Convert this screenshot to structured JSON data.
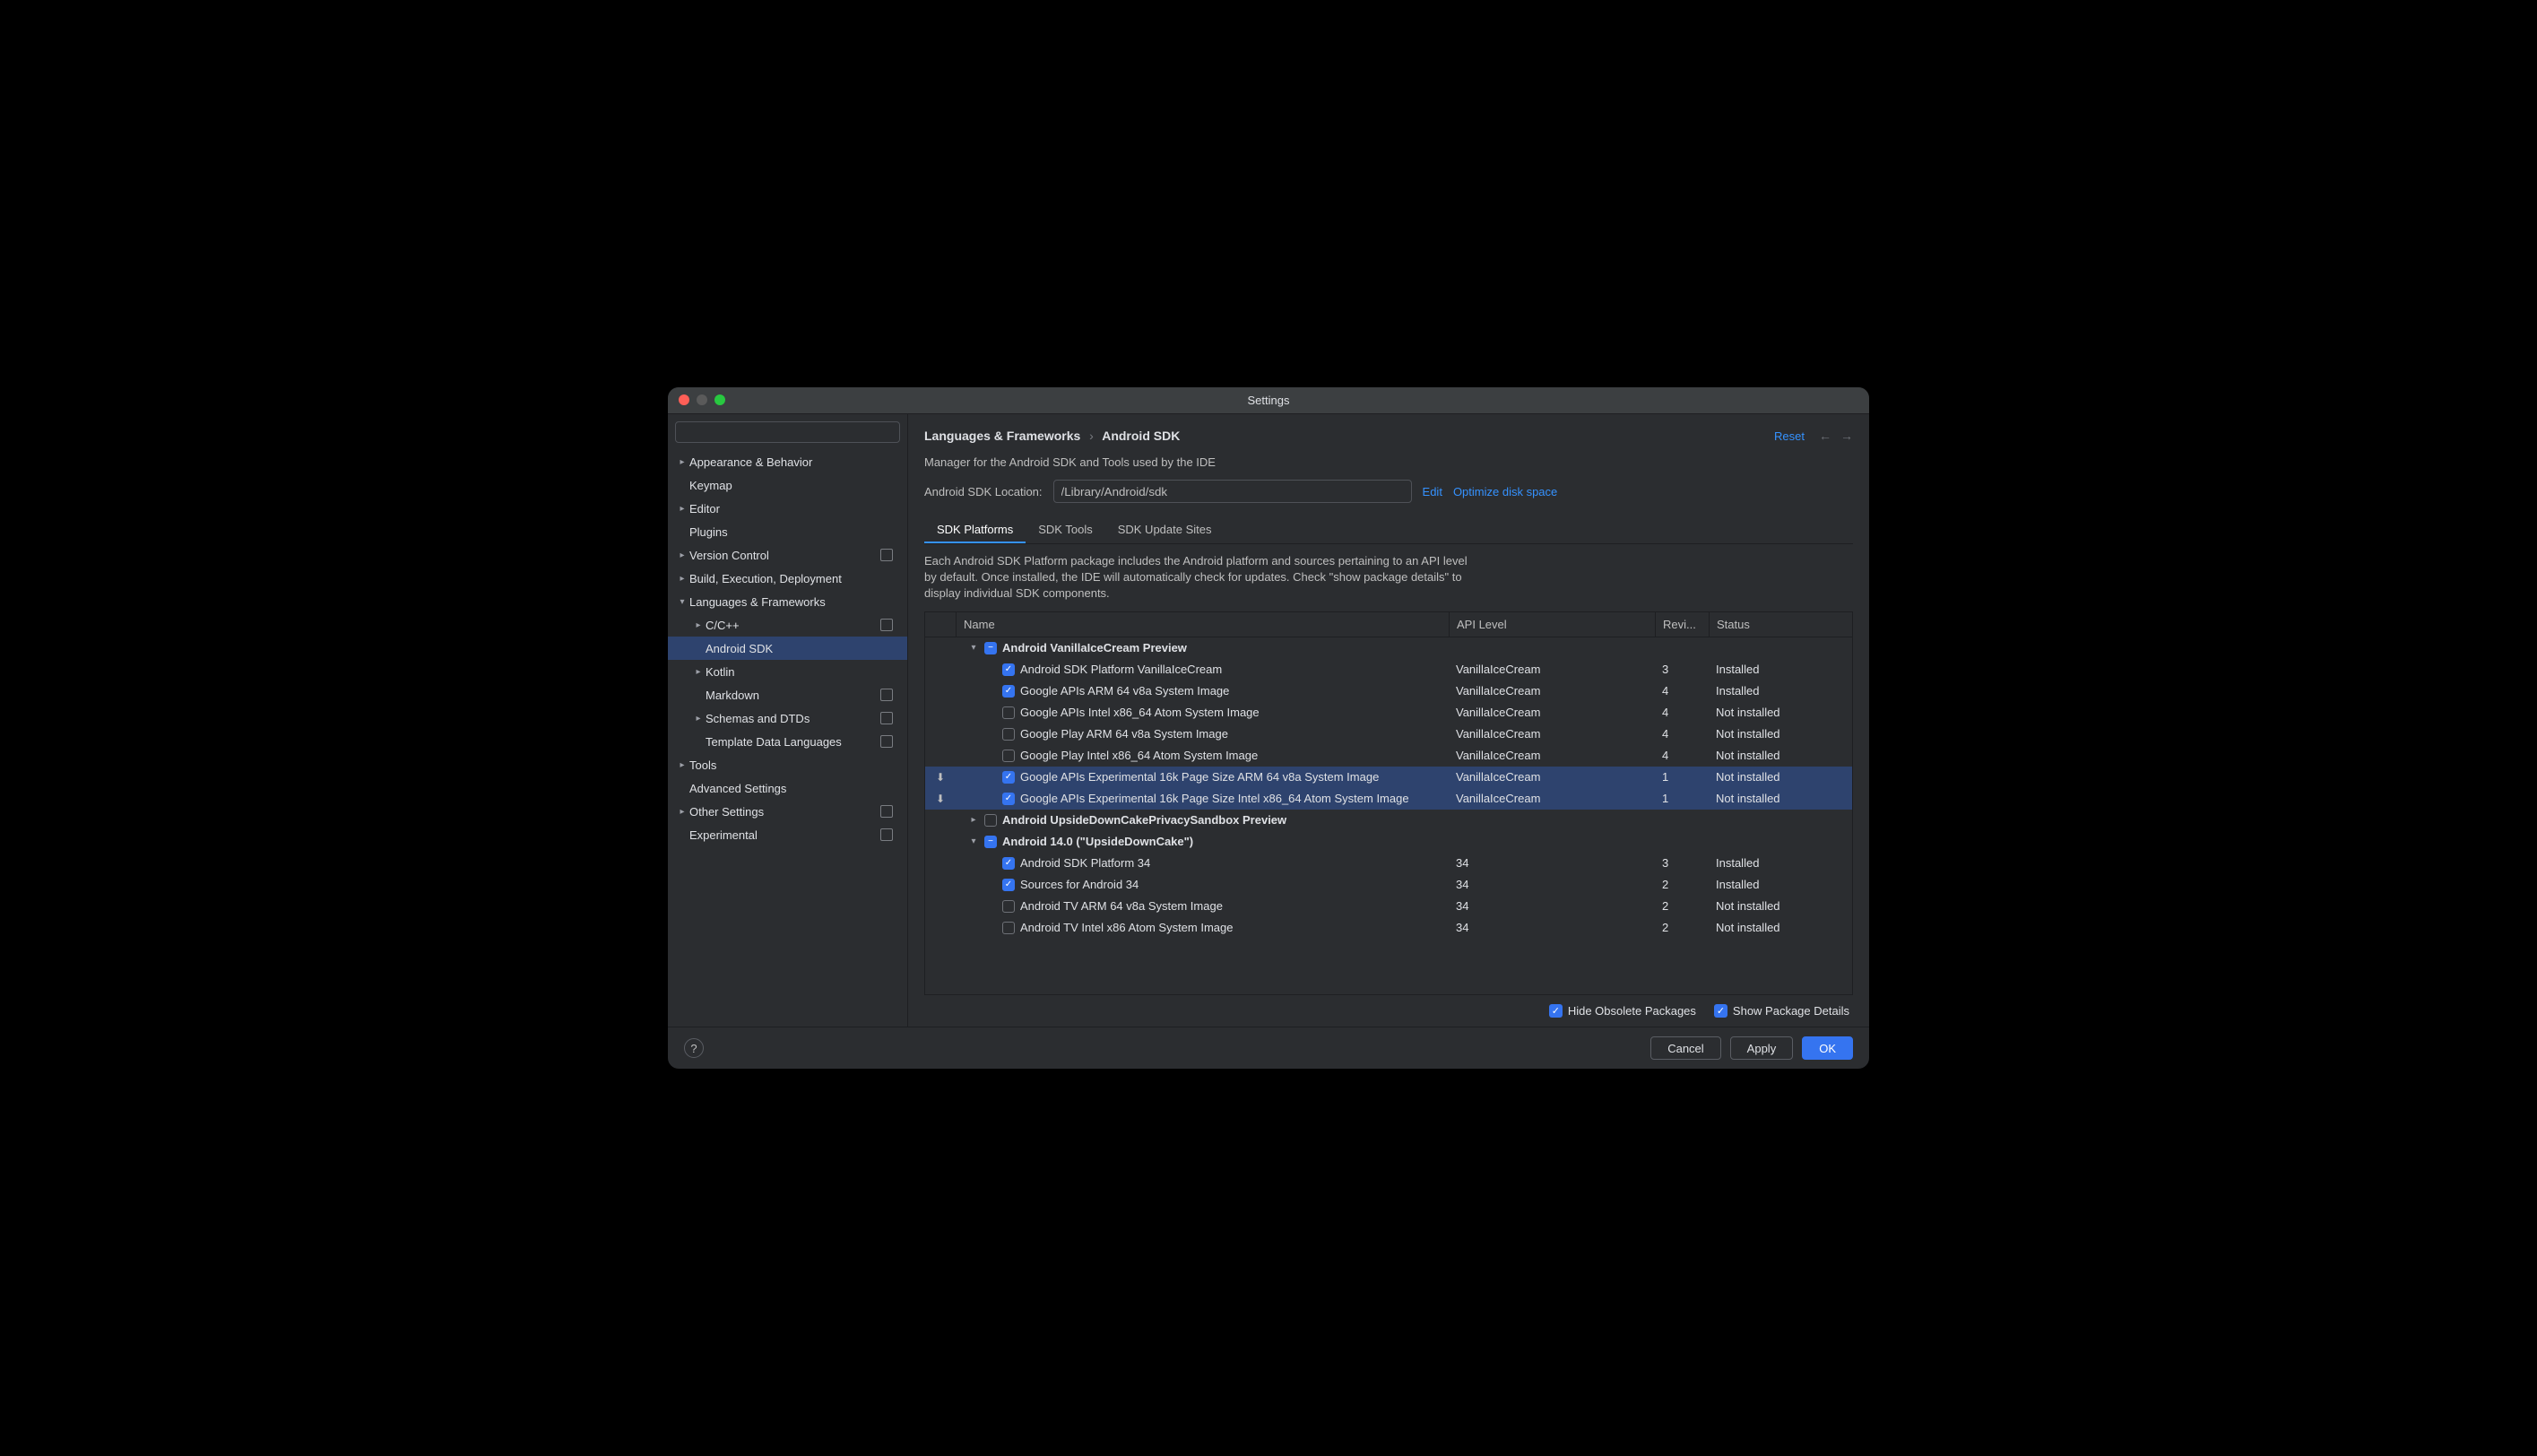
{
  "window": {
    "title": "Settings"
  },
  "search": {
    "placeholder": ""
  },
  "sidebar": {
    "items": [
      {
        "label": "Appearance & Behavior",
        "depth": 0,
        "chev": "right",
        "mod": false
      },
      {
        "label": "Keymap",
        "depth": 0,
        "chev": "none",
        "mod": false
      },
      {
        "label": "Editor",
        "depth": 0,
        "chev": "right",
        "mod": false
      },
      {
        "label": "Plugins",
        "depth": 0,
        "chev": "none",
        "mod": false
      },
      {
        "label": "Version Control",
        "depth": 0,
        "chev": "right",
        "mod": true
      },
      {
        "label": "Build, Execution, Deployment",
        "depth": 0,
        "chev": "right",
        "mod": false
      },
      {
        "label": "Languages & Frameworks",
        "depth": 0,
        "chev": "down",
        "mod": false
      },
      {
        "label": "C/C++",
        "depth": 1,
        "chev": "right",
        "mod": true
      },
      {
        "label": "Android SDK",
        "depth": 1,
        "chev": "none",
        "mod": false,
        "selected": true
      },
      {
        "label": "Kotlin",
        "depth": 1,
        "chev": "right",
        "mod": false
      },
      {
        "label": "Markdown",
        "depth": 1,
        "chev": "none",
        "mod": true
      },
      {
        "label": "Schemas and DTDs",
        "depth": 1,
        "chev": "right",
        "mod": true
      },
      {
        "label": "Template Data Languages",
        "depth": 1,
        "chev": "none",
        "mod": true
      },
      {
        "label": "Tools",
        "depth": 0,
        "chev": "right",
        "mod": false
      },
      {
        "label": "Advanced Settings",
        "depth": 0,
        "chev": "none",
        "mod": false
      },
      {
        "label": "Other Settings",
        "depth": 0,
        "chev": "right",
        "mod": true
      },
      {
        "label": "Experimental",
        "depth": 0,
        "chev": "none",
        "mod": true
      }
    ]
  },
  "breadcrumb": {
    "parent": "Languages & Frameworks",
    "current": "Android SDK"
  },
  "reset_label": "Reset",
  "subtitle": "Manager for the Android SDK and Tools used by the IDE",
  "location": {
    "label": "Android SDK Location:",
    "value": "/Library/Android/sdk",
    "edit": "Edit",
    "optimize": "Optimize disk space"
  },
  "tabs": [
    {
      "label": "SDK Platforms",
      "active": true
    },
    {
      "label": "SDK Tools",
      "active": false
    },
    {
      "label": "SDK Update Sites",
      "active": false
    }
  ],
  "description": "Each Android SDK Platform package includes the Android platform and sources pertaining to an API level by default. Once installed, the IDE will automatically check for updates. Check \"show package details\" to display individual SDK components.",
  "columns": {
    "name": "Name",
    "api": "API Level",
    "rev": "Revi...",
    "status": "Status"
  },
  "rows": [
    {
      "type": "group",
      "label": "Android VanillaIceCream Preview",
      "chev": "down",
      "cb": "indet",
      "depth": 0
    },
    {
      "type": "item",
      "label": "Android SDK Platform VanillaIceCream",
      "cb": "checked",
      "api": "VanillaIceCream",
      "rev": "3",
      "status": "Installed",
      "depth": 1
    },
    {
      "type": "item",
      "label": "Google APIs ARM 64 v8a System Image",
      "cb": "checked",
      "api": "VanillaIceCream",
      "rev": "4",
      "status": "Installed",
      "depth": 1
    },
    {
      "type": "item",
      "label": "Google APIs Intel x86_64 Atom System Image",
      "cb": "off",
      "api": "VanillaIceCream",
      "rev": "4",
      "status": "Not installed",
      "depth": 1
    },
    {
      "type": "item",
      "label": "Google Play ARM 64 v8a System Image",
      "cb": "off",
      "api": "VanillaIceCream",
      "rev": "4",
      "status": "Not installed",
      "depth": 1
    },
    {
      "type": "item",
      "label": "Google Play Intel x86_64 Atom System Image",
      "cb": "off",
      "api": "VanillaIceCream",
      "rev": "4",
      "status": "Not installed",
      "depth": 1
    },
    {
      "type": "item",
      "label": "Google APIs Experimental 16k Page Size ARM 64 v8a System Image",
      "cb": "checked",
      "api": "VanillaIceCream",
      "rev": "1",
      "status": "Not installed",
      "depth": 1,
      "sel": true,
      "dl": true
    },
    {
      "type": "item",
      "label": "Google APIs Experimental 16k Page Size Intel x86_64 Atom System Image",
      "cb": "checked",
      "api": "VanillaIceCream",
      "rev": "1",
      "status": "Not installed",
      "depth": 1,
      "sel": true,
      "dl": true
    },
    {
      "type": "group",
      "label": "Android UpsideDownCakePrivacySandbox Preview",
      "chev": "right",
      "cb": "off",
      "depth": 0
    },
    {
      "type": "group",
      "label": "Android 14.0 (\"UpsideDownCake\")",
      "chev": "down",
      "cb": "indet",
      "depth": 0
    },
    {
      "type": "item",
      "label": "Android SDK Platform 34",
      "cb": "checked",
      "api": "34",
      "rev": "3",
      "status": "Installed",
      "depth": 1
    },
    {
      "type": "item",
      "label": "Sources for Android 34",
      "cb": "checked",
      "api": "34",
      "rev": "2",
      "status": "Installed",
      "depth": 1
    },
    {
      "type": "item",
      "label": "Android TV ARM 64 v8a System Image",
      "cb": "off",
      "api": "34",
      "rev": "2",
      "status": "Not installed",
      "depth": 1
    },
    {
      "type": "item",
      "label": "Android TV Intel x86 Atom System Image",
      "cb": "off",
      "api": "34",
      "rev": "2",
      "status": "Not installed",
      "depth": 1
    }
  ],
  "footer_opts": {
    "hide": "Hide Obsolete Packages",
    "show": "Show Package Details"
  },
  "buttons": {
    "cancel": "Cancel",
    "apply": "Apply",
    "ok": "OK"
  }
}
